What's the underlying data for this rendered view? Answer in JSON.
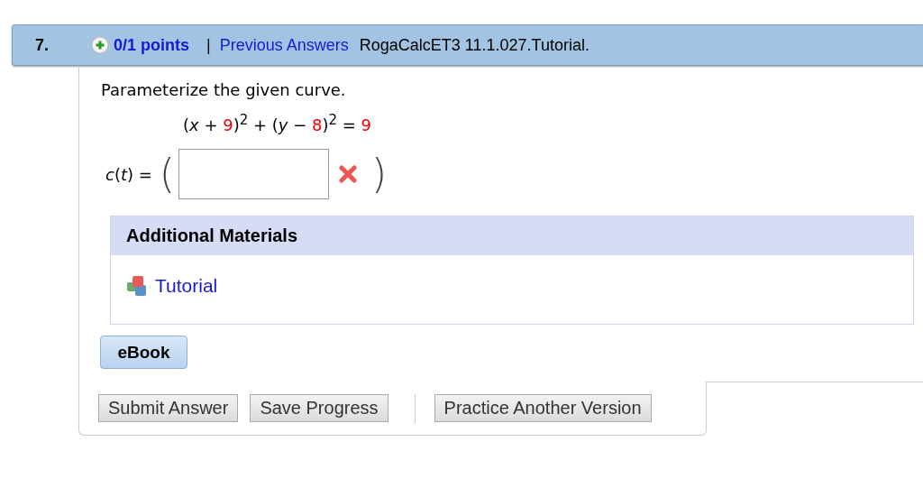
{
  "question": {
    "number": "7.",
    "points": "0/1 points",
    "separator": "|",
    "previous_answers": "Previous Answers",
    "source": "RogaCalcET3 11.1.027.Tutorial."
  },
  "prompt": "Parameterize the given curve.",
  "equation": [
    {
      "kind": "plain",
      "text": "(*x* + "
    },
    {
      "kind": "value",
      "text": "9"
    },
    {
      "kind": "plain",
      "text": ")$^{2}$ + (*y* − "
    },
    {
      "kind": "value",
      "text": "8"
    },
    {
      "kind": "plain",
      "text": ")$^{2}$ = "
    },
    {
      "kind": "value",
      "text": "9"
    }
  ],
  "answer": {
    "label": "*c*(*t*) =",
    "open_paren": "(",
    "close_paren": ")",
    "correct": false
  },
  "additional_materials": {
    "title": "Additional Materials",
    "items": [
      {
        "label": "Tutorial"
      }
    ]
  },
  "ebook": "eBook",
  "buttons": [
    "Submit Answer",
    "Save Progress"
  ],
  "practice_button": "Practice Another Version"
}
